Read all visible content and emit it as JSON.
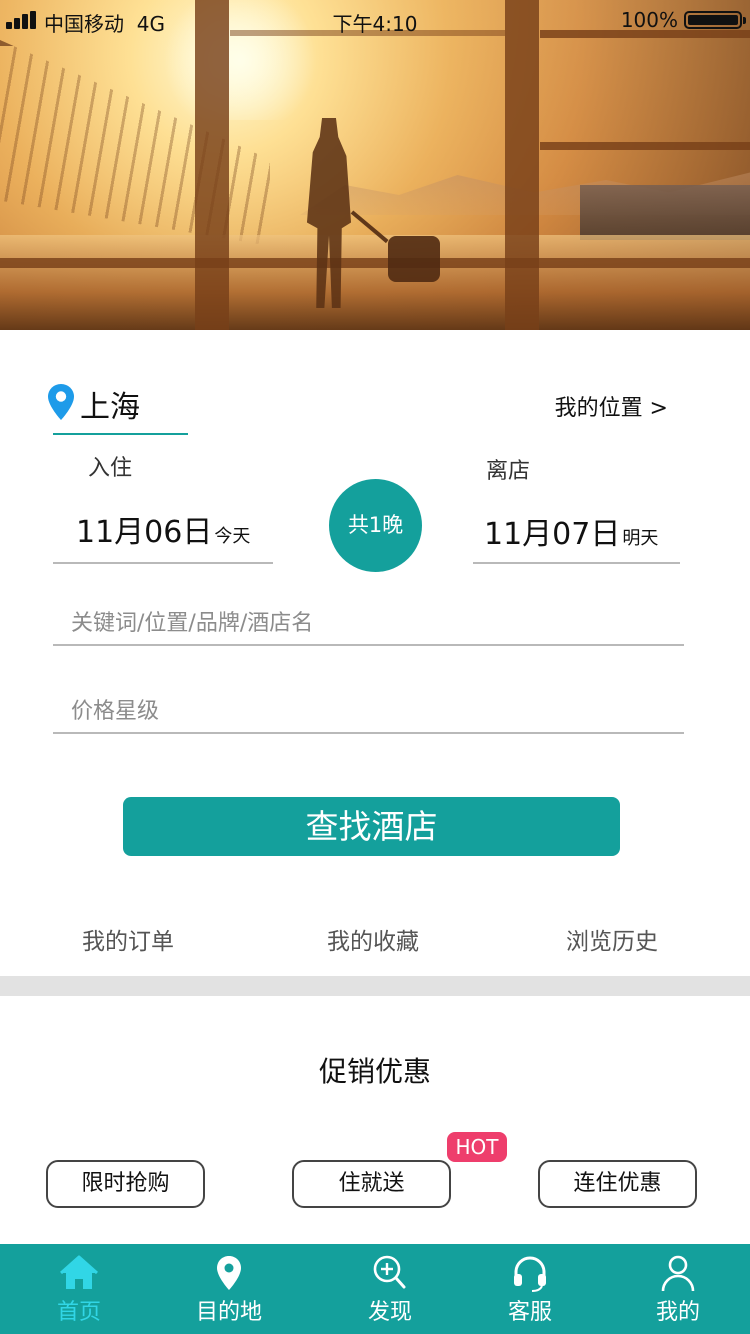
{
  "status_bar": {
    "carrier": "中国移动",
    "network": "4G",
    "time": "下午4:10",
    "battery": "100%"
  },
  "search": {
    "city": "上海",
    "my_location": "我的位置  >",
    "checkin_label": "入住",
    "checkout_label": "离店",
    "checkin_date": "11月06日",
    "checkin_day": "今天",
    "checkout_date": "11月07日",
    "checkout_day": "明天",
    "nights": "共1晚",
    "keyword_placeholder": "关键词/位置/品牌/酒店名",
    "price_placeholder": "价格星级",
    "button": "查找酒店"
  },
  "quick_links": [
    "我的订单",
    "我的收藏",
    "浏览历史"
  ],
  "promotions": {
    "title": "促销优惠",
    "items": [
      "限时抢购",
      "住就送",
      "连住优惠"
    ],
    "hot_badge": "HOT"
  },
  "tabbar": {
    "items": [
      "首页",
      "目的地",
      "发现",
      "客服",
      "我的"
    ],
    "active_index": 0
  },
  "colors": {
    "primary": "#14a09c",
    "tab_active": "#31d6e6",
    "hot": "#ee3e6c",
    "pin": "#1e9be9"
  }
}
